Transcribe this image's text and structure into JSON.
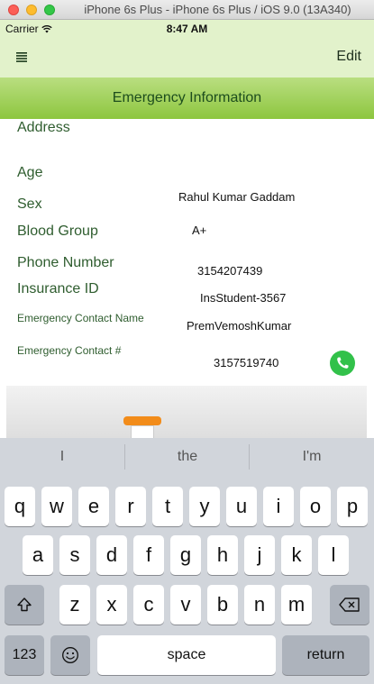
{
  "simulator": {
    "title": "iPhone 6s Plus - iPhone 6s Plus / iOS 9.0 (13A340)"
  },
  "status_bar": {
    "carrier": "Carrier",
    "time": "8:47 AM"
  },
  "navbar": {
    "menu_icon": "hamburger-menu-icon",
    "edit_label": "Edit"
  },
  "header": {
    "title": "Emergency Information"
  },
  "fields": {
    "address": {
      "label": "Address"
    },
    "age": {
      "label": "Age"
    },
    "name": {
      "value": "Rahul Kumar Gaddam"
    },
    "sex": {
      "label": "Sex"
    },
    "blood_group": {
      "label": "Blood Group",
      "value": "A+"
    },
    "phone": {
      "label": "Phone Number",
      "value": "3154207439"
    },
    "insurance": {
      "label": "Insurance ID",
      "value": "InsStudent-3567"
    },
    "emergency_name": {
      "label": "Emergency Contact Name",
      "value": "PremVemoshKumar"
    },
    "emergency_number": {
      "label": "Emergency Contact  #",
      "value": "3157519740"
    }
  },
  "keyboard": {
    "suggestions": [
      "I",
      "the",
      "I'm"
    ],
    "row1": [
      "q",
      "w",
      "e",
      "r",
      "t",
      "y",
      "u",
      "i",
      "o",
      "p"
    ],
    "row2": [
      "a",
      "s",
      "d",
      "f",
      "g",
      "h",
      "j",
      "k",
      "l"
    ],
    "row3": [
      "z",
      "x",
      "c",
      "v",
      "b",
      "n",
      "m"
    ],
    "numbers_label": "123",
    "space_label": "space",
    "return_label": "return"
  }
}
